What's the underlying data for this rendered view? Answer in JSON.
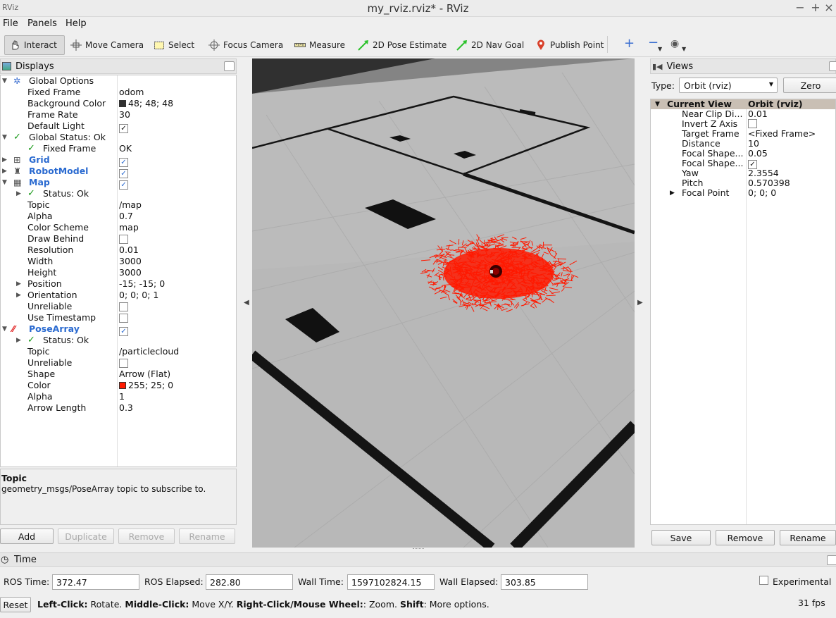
{
  "window": {
    "title": "my_rviz.rviz* - RViz"
  },
  "menu": {
    "file": "File",
    "panels": "Panels",
    "help": "Help"
  },
  "toolbar": {
    "interact": "Interact",
    "move_camera": "Move Camera",
    "select": "Select",
    "focus_camera": "Focus Camera",
    "measure": "Measure",
    "pose_estimate": "2D Pose Estimate",
    "nav_goal": "2D Nav Goal",
    "publish_point": "Publish Point"
  },
  "displays": {
    "title": "Displays",
    "global_options": "Global Options",
    "fixed_frame_k": "Fixed Frame",
    "fixed_frame_v": "odom",
    "bg_color_k": "Background Color",
    "bg_color_v": "48; 48; 48",
    "frame_rate_k": "Frame Rate",
    "frame_rate_v": "30",
    "default_light_k": "Default Light",
    "global_status": "Global Status: Ok",
    "gs_fixed_frame_k": "Fixed Frame",
    "gs_fixed_frame_v": "OK",
    "grid": "Grid",
    "robot_model": "RobotModel",
    "map": "Map",
    "map_status": "Status: Ok",
    "map_topic_k": "Topic",
    "map_topic_v": "/map",
    "map_alpha_k": "Alpha",
    "map_alpha_v": "0.7",
    "color_scheme_k": "Color Scheme",
    "color_scheme_v": "map",
    "draw_behind_k": "Draw Behind",
    "resolution_k": "Resolution",
    "resolution_v": "0.01",
    "width_k": "Width",
    "width_v": "3000",
    "height_k": "Height",
    "height_v": "3000",
    "position_k": "Position",
    "position_v": "-15; -15; 0",
    "orientation_k": "Orientation",
    "orientation_v": "0; 0; 0; 1",
    "map_unreliable_k": "Unreliable",
    "use_timestamp_k": "Use Timestamp",
    "pose_array": "PoseArray",
    "pa_status": "Status: Ok",
    "pa_topic_k": "Topic",
    "pa_topic_v": "/particlecloud",
    "pa_unreliable_k": "Unreliable",
    "shape_k": "Shape",
    "shape_v": "Arrow (Flat)",
    "pa_color_k": "Color",
    "pa_color_v": "255; 25; 0",
    "pa_alpha_k": "Alpha",
    "pa_alpha_v": "1",
    "arrow_length_k": "Arrow Length",
    "arrow_length_v": "0.3"
  },
  "description": {
    "title": "Topic",
    "text": "geometry_msgs/PoseArray topic to subscribe to."
  },
  "display_buttons": {
    "add": "Add",
    "duplicate": "Duplicate",
    "remove": "Remove",
    "rename": "Rename"
  },
  "views": {
    "title": "Views",
    "type_label": "Type:",
    "type_value": "Orbit (rviz)",
    "zero": "Zero",
    "current_view_k": "Current View",
    "current_view_v": "Orbit (rviz)",
    "near_clip_k": "Near Clip Di...",
    "near_clip_v": "0.01",
    "invert_z_k": "Invert Z Axis",
    "target_frame_k": "Target Frame",
    "target_frame_v": "<Fixed Frame>",
    "distance_k": "Distance",
    "distance_v": "10",
    "focal_size_k": "Focal Shape...",
    "focal_size_v": "0.05",
    "focal_fixed_k": "Focal Shape...",
    "yaw_k": "Yaw",
    "yaw_v": "2.3554",
    "pitch_k": "Pitch",
    "pitch_v": "0.570398",
    "focal_point_k": "Focal Point",
    "focal_point_v": "0; 0; 0",
    "save": "Save",
    "remove": "Remove",
    "rename": "Rename"
  },
  "time": {
    "title": "Time",
    "ros_time_label": "ROS Time:",
    "ros_time": "372.47",
    "ros_elapsed_label": "ROS Elapsed:",
    "ros_elapsed": "282.80",
    "wall_time_label": "Wall Time:",
    "wall_time": "1597102824.15",
    "wall_elapsed_label": "Wall Elapsed:",
    "wall_elapsed": "303.85",
    "experimental": "Experimental"
  },
  "status": {
    "reset": "Reset",
    "hint_1b": "Left-Click:",
    "hint_1": " Rotate. ",
    "hint_2b": "Middle-Click:",
    "hint_2": " Move X/Y. ",
    "hint_3b": "Right-Click/Mouse Wheel:",
    "hint_3": ": Zoom. ",
    "hint_4b": "Shift",
    "hint_4": ": More options.",
    "fps": "31 fps"
  },
  "colors": {
    "background": "#303030",
    "particles": "#ff1900",
    "accent": "#2a6ad0"
  }
}
